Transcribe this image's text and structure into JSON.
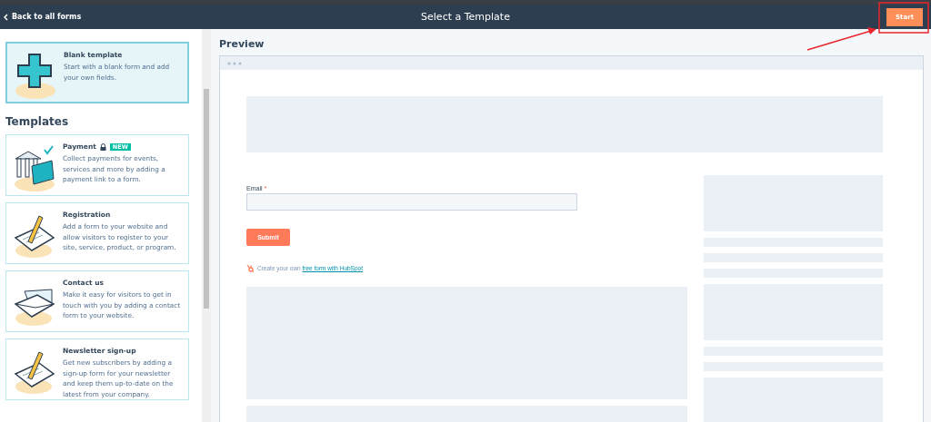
{
  "header": {
    "back_link": "Back to all forms",
    "title": "Select a Template",
    "start_button": "Start"
  },
  "blank_template": {
    "title": "Blank template",
    "description": "Start with a blank form and add your own fields.",
    "selected": true,
    "kind": "plus"
  },
  "templates_heading": "Templates",
  "templates": [
    {
      "title": "Payment",
      "locked": true,
      "badge": "NEW",
      "description": "Collect payments for events, services and more by adding a payment link to a form.",
      "selected": false,
      "kind": "bank"
    },
    {
      "title": "Registration",
      "locked": false,
      "description": "Add a form to your website and allow visitors to register to your site, service, product, or program.",
      "selected": false,
      "kind": "pencil"
    },
    {
      "title": "Contact us",
      "locked": false,
      "description": "Make it easy for visitors to get in touch with you by adding a contact form to your website.",
      "selected": false,
      "kind": "envelope"
    },
    {
      "title": "Newsletter sign-up",
      "locked": false,
      "description": "Get new subscribers by adding a sign-up form for your newsletter and keep them up-to-date on the latest from your company.",
      "selected": false,
      "kind": "pencil"
    }
  ],
  "preview": {
    "heading": "Preview",
    "email_label": "Email",
    "required_mark": "*",
    "submit_button": "Submit",
    "credit_text": "Create your own",
    "credit_link": "free form with HubSpot"
  }
}
